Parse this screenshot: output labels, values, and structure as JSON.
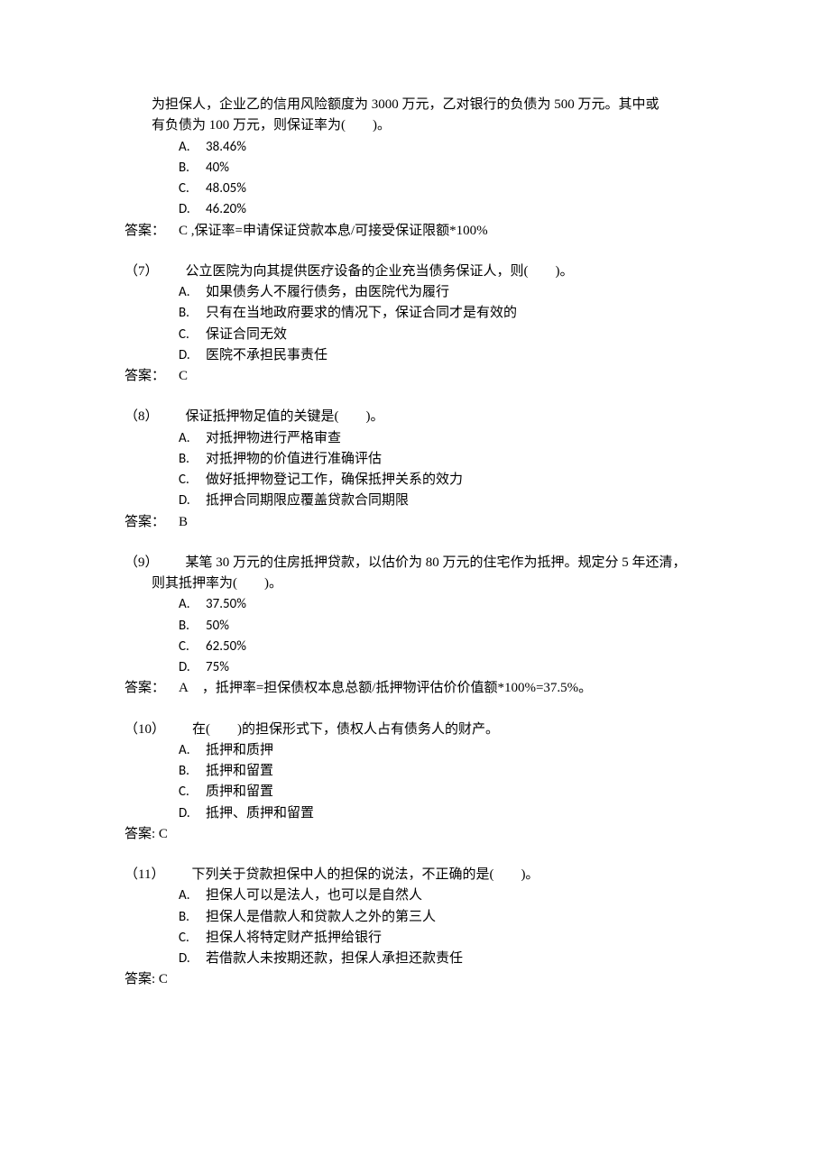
{
  "q6": {
    "cont_line1": "为担保人，企业乙的信用风险额度为 3000 万元，乙对银行的负债为 500 万元。其中或",
    "cont_line2": "有负债为 100 万元，则保证率为(  )。",
    "options": {
      "A": "38.46%",
      "B": "40%",
      "C": "48.05%",
      "D": "46.20%"
    },
    "answer": "答案： C ,保证率=申请保证贷款本息/可接受保证限额*100%"
  },
  "q7": {
    "prompt": "（7）  公立医院为向其提供医疗设备的企业充当债务保证人，则(  )。",
    "options": {
      "A": "如果债务人不履行债务，由医院代为履行",
      "B": "只有在当地政府要求的情况下，保证合同才是有效的",
      "C": "保证合同无效",
      "D": "医院不承担民事责任"
    },
    "answer": "答案： C"
  },
  "q8": {
    "prompt": "（8）  保证抵押物足值的关键是(  )。",
    "options": {
      "A": "对抵押物进行严格审查",
      "B": "对抵押物的价值进行准确评估",
      "C": "做好抵押物登记工作，确保抵押关系的效力",
      "D": "抵押合同期限应覆盖贷款合同期限"
    },
    "answer": "答案： B"
  },
  "q9": {
    "prompt_line1": "（9）  某笔 30 万元的住房抵押贷款，以估价为 80 万元的住宅作为抵押。规定分 5 年还清，",
    "prompt_line2": "则其抵押率为(  )。",
    "options": {
      "A": "37.50%",
      "B": "50%",
      "C": "62.50%",
      "D": "75%"
    },
    "answer": "答案： A ，抵押率=担保债权本息总额/抵押物评估价价值额*100%=37.5%。"
  },
  "q10": {
    "prompt": "（10）  在(  )的担保形式下，债权人占有债务人的财产。",
    "options": {
      "A": "抵押和质押",
      "B": "抵押和留置",
      "C": "质押和留置",
      "D": "抵押、质押和留置"
    },
    "answer": "答案: C"
  },
  "q11": {
    "prompt": "（11）  下列关于贷款担保中人的担保的说法，不正确的是(  )。",
    "options": {
      "A": "担保人可以是法人，也可以是自然人",
      "B": "担保人是借款人和贷款人之外的第三人",
      "C": "担保人将特定财产抵押给银行",
      "D": "若借款人未按期还款，担保人承担还款责任"
    },
    "answer": "答案: C"
  },
  "letters": {
    "A": "A.",
    "B": "B.",
    "C": "C.",
    "D": "D."
  }
}
